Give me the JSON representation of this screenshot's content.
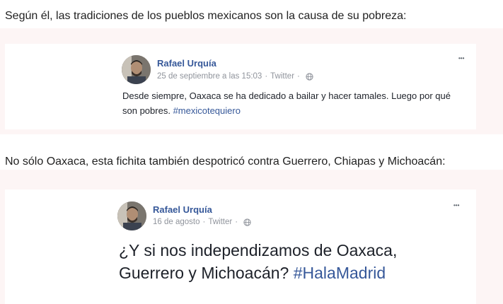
{
  "captions": {
    "first": "Según él, las tradiciones de los pueblos mexicanos son la causa de su pobreza:",
    "second": "No sólo Oaxaca, esta fichita también despotricó contra Guerrero, Chiapas y Michoacán:"
  },
  "posts": [
    {
      "author": "Rafael Urquía",
      "date": "25 de septiembre a las 15:03",
      "source": "Twitter",
      "separator": "·",
      "text": "Desde siempre, Oaxaca se ha dedicado a bailar y hacer tamales. Luego por qué son pobres.",
      "hashtag": "#mexicotequiero",
      "more": "•••"
    },
    {
      "author": "Rafael Urquía",
      "date": "16 de agosto",
      "source": "Twitter",
      "separator": "·",
      "text": "¿Y si nos independizamos de Oaxaca, Guerrero y Michoacán?",
      "hashtag": "#HalaMadrid",
      "more": "•••"
    }
  ],
  "colors": {
    "band": "#fdf5f5",
    "author": "#365899",
    "hashtag": "#365899",
    "meta": "#90949c"
  },
  "icons": [
    "globe-icon",
    "more-options-icon",
    "avatar-photo"
  ]
}
